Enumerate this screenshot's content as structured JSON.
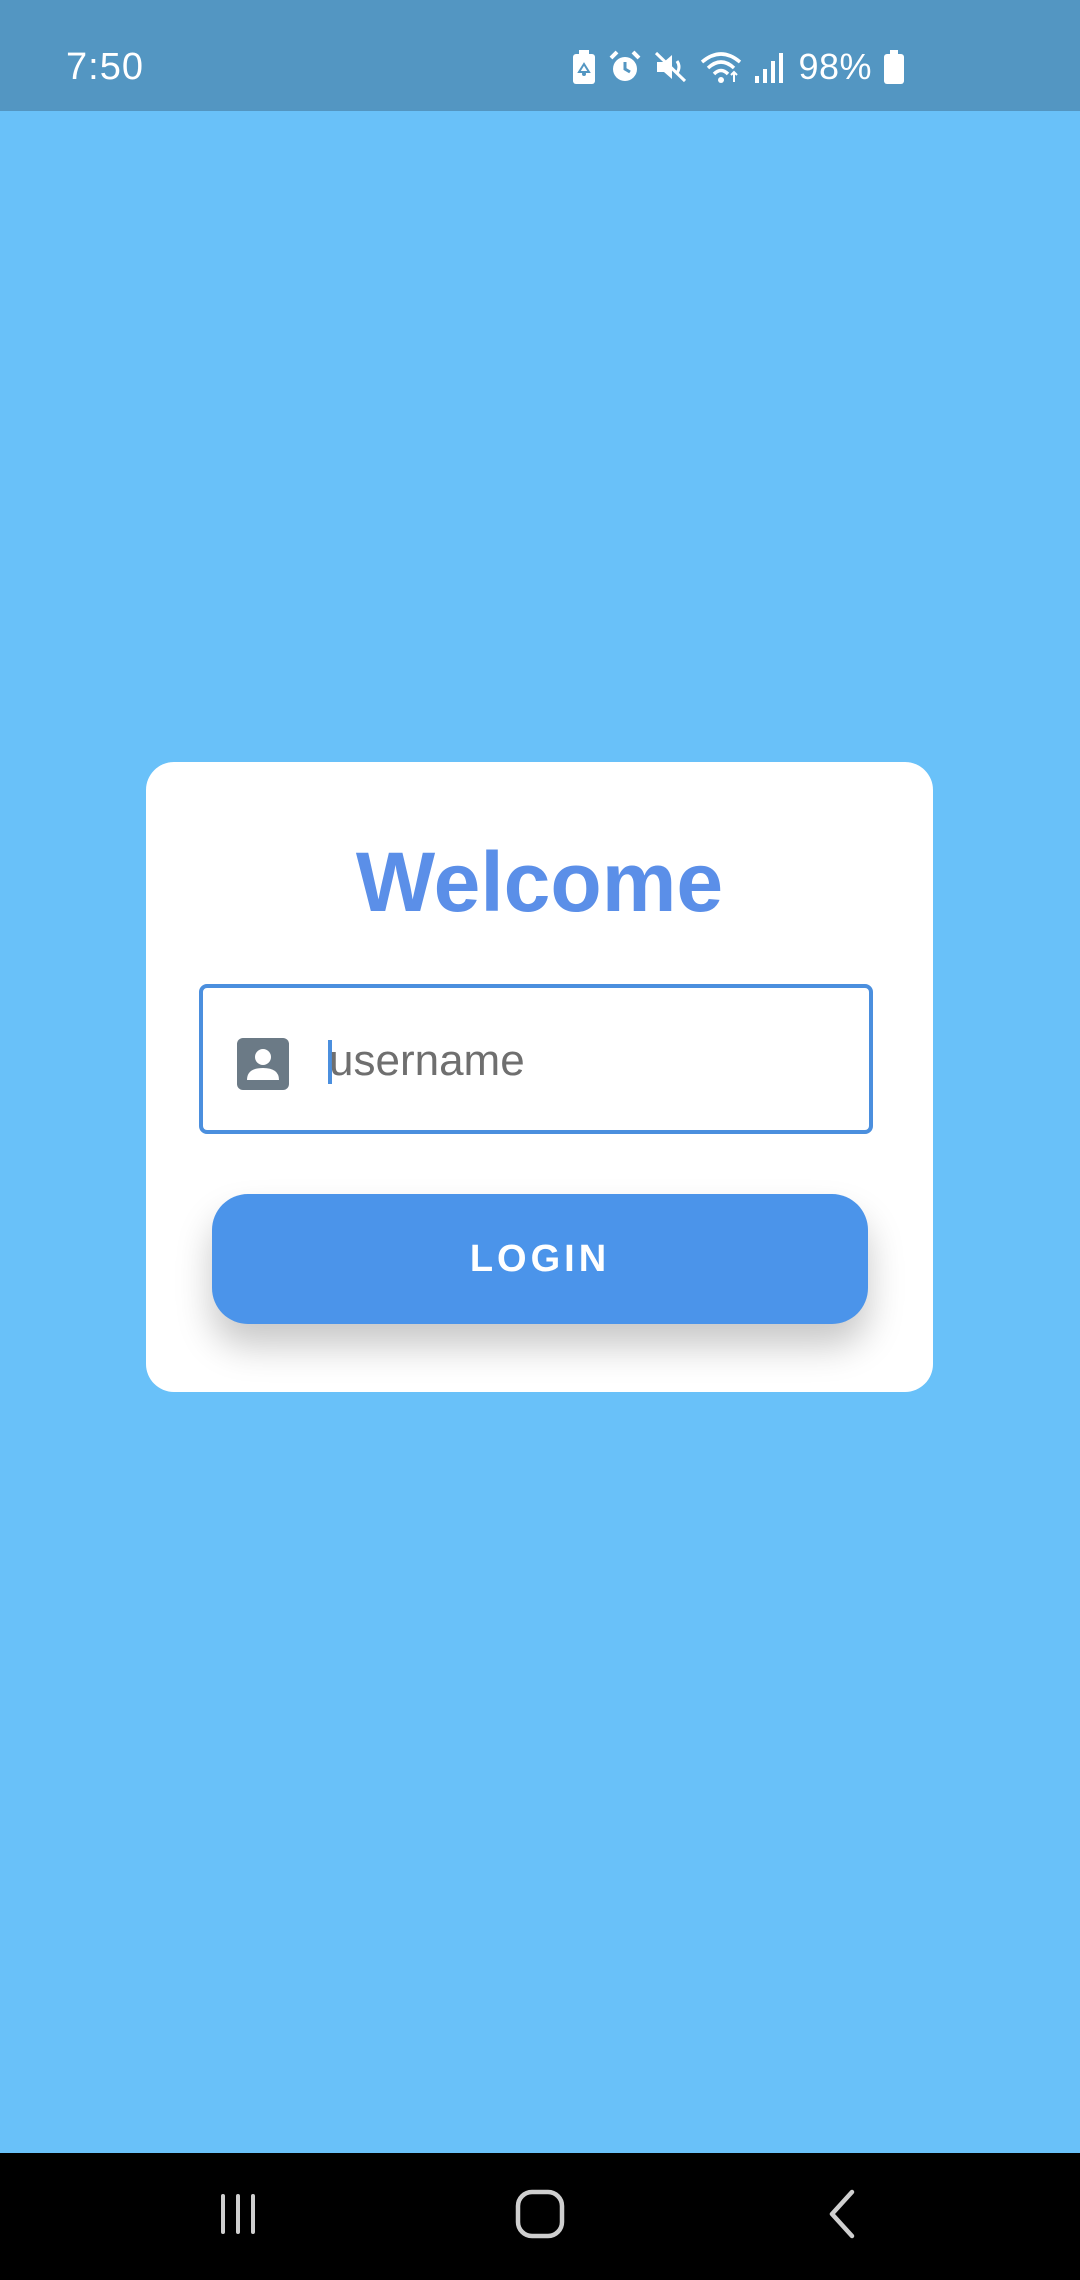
{
  "status_bar": {
    "time": "7:50",
    "battery_percent": "98%",
    "icons": [
      "battery-saver-icon",
      "alarm-icon",
      "mute-icon",
      "wifi-icon",
      "signal-icon",
      "battery-icon"
    ]
  },
  "login_card": {
    "title": "Welcome",
    "username_field": {
      "placeholder": "username",
      "value": "",
      "icon": "account-box-icon"
    },
    "login_button_label": "LOGIN"
  },
  "navigation_bar": {
    "buttons": [
      "recent-apps-icon",
      "home-icon",
      "back-icon"
    ]
  },
  "colors": {
    "background": "#69c1f9",
    "status_bar": "#5396c2",
    "accent": "#5b8fe8",
    "button": "#4b94ea",
    "field_border": "#4b8fde"
  }
}
